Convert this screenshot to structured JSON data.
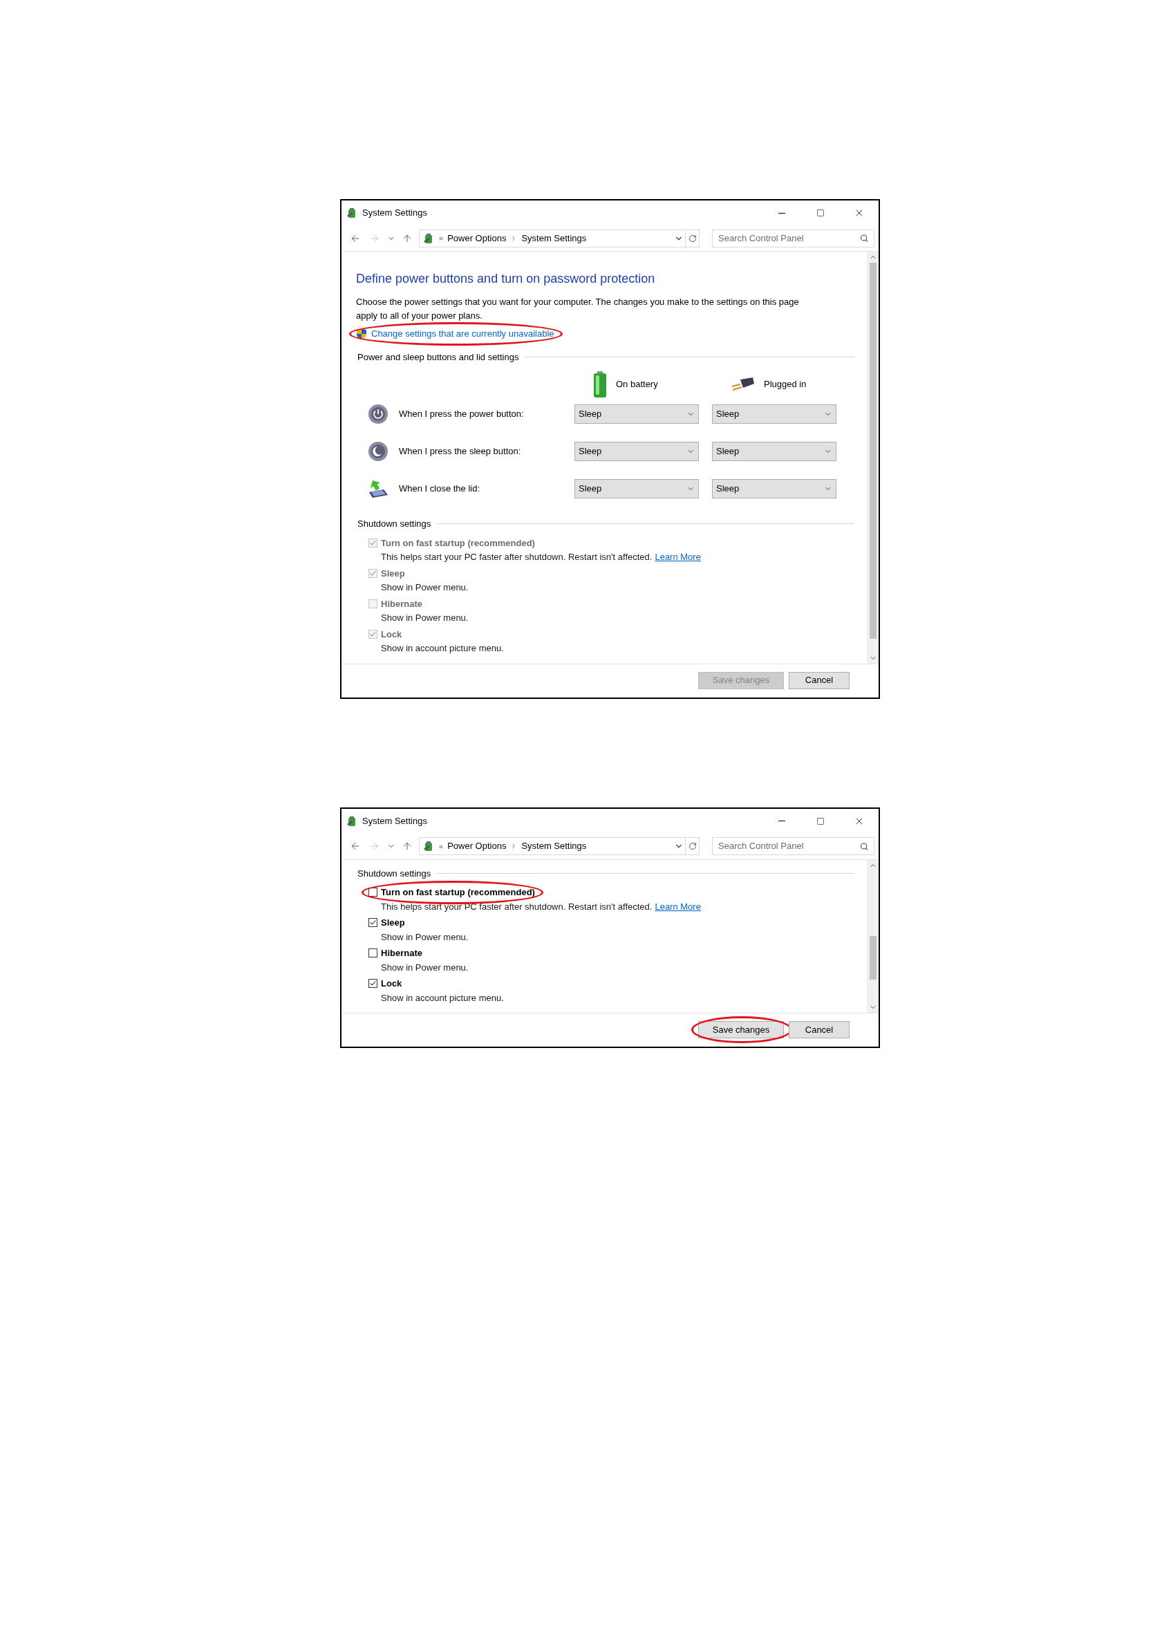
{
  "screenshots": [
    {
      "window": {
        "title": "System Settings"
      },
      "address": {
        "prefix": "«",
        "path": [
          "Power Options",
          "System Settings"
        ]
      },
      "search": {
        "placeholder": "Search Control Panel"
      },
      "scrolled_down": false,
      "heading": "Define power buttons and turn on password protection",
      "description": "Choose the power settings that you want for your computer. The changes you make to the settings on this page apply to all of your power plans.",
      "admin_link": {
        "label": "Change settings that are currently unavailable",
        "highlighted": true
      },
      "power_section": {
        "title": "Power and sleep buttons and lid settings",
        "columns": [
          {
            "kind": "battery",
            "label": "On battery"
          },
          {
            "kind": "plug",
            "label": "Plugged in"
          }
        ],
        "rows": [
          {
            "kind": "power",
            "label": "When I press the power button:",
            "values": [
              "Sleep",
              "Sleep"
            ]
          },
          {
            "kind": "sleep",
            "label": "When I press the sleep button:",
            "values": [
              "Sleep",
              "Sleep"
            ]
          },
          {
            "kind": "lid",
            "label": "When I close the lid:",
            "values": [
              "Sleep",
              "Sleep"
            ]
          }
        ]
      },
      "shutdown_section": {
        "title": "Shutdown settings",
        "options": [
          {
            "label": "Turn on fast startup (recommended)",
            "description": "This helps start your PC faster after shutdown. Restart isn't affected.",
            "link": "Learn More",
            "checked": true,
            "disabled": true
          },
          {
            "label": "Sleep",
            "description": "Show in Power menu.",
            "checked": true,
            "disabled": true
          },
          {
            "label": "Hibernate",
            "description": "Show in Power menu.",
            "checked": false,
            "disabled": true
          },
          {
            "label": "Lock",
            "description": "Show in account picture menu.",
            "checked": true,
            "disabled": true
          }
        ]
      },
      "buttons": [
        {
          "label": "Save changes",
          "disabled": true,
          "highlighted": false
        },
        {
          "label": "Cancel",
          "disabled": false,
          "highlighted": false
        }
      ]
    },
    {
      "window": {
        "title": "System Settings"
      },
      "address": {
        "prefix": "«",
        "path": [
          "Power Options",
          "System Settings"
        ]
      },
      "search": {
        "placeholder": "Search Control Panel"
      },
      "scrolled_down": true,
      "shutdown_section": {
        "title": "Shutdown settings",
        "options": [
          {
            "label": "Turn on fast startup (recommended)",
            "description": "This helps start your PC faster after shutdown. Restart isn't affected.",
            "link": "Learn More",
            "checked": false,
            "disabled": false,
            "highlighted": true
          },
          {
            "label": "Sleep",
            "description": "Show in Power menu.",
            "checked": true,
            "disabled": false
          },
          {
            "label": "Hibernate",
            "description": "Show in Power menu.",
            "checked": false,
            "disabled": false
          },
          {
            "label": "Lock",
            "description": "Show in account picture menu.",
            "checked": true,
            "disabled": false
          }
        ]
      },
      "buttons": [
        {
          "label": "Save changes",
          "disabled": false,
          "highlighted": true
        },
        {
          "label": "Cancel",
          "disabled": false,
          "highlighted": false
        }
      ]
    }
  ]
}
